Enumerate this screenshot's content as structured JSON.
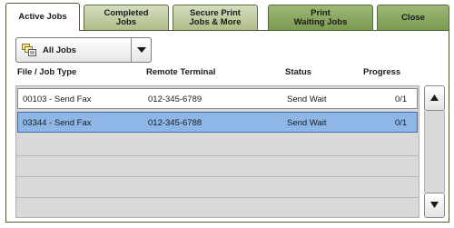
{
  "tabs": [
    {
      "label_line1": "Active Jobs",
      "label_line2": ""
    },
    {
      "label_line1": "Completed",
      "label_line2": "Jobs"
    },
    {
      "label_line1": "Secure Print",
      "label_line2": "Jobs & More"
    },
    {
      "label_line1": "Print",
      "label_line2": "Waiting Jobs"
    },
    {
      "label_line1": "Close",
      "label_line2": ""
    }
  ],
  "filter": {
    "selected": "All Jobs",
    "icon": "job-list-icon"
  },
  "columns": {
    "file_job_type": "File / Job Type",
    "remote_terminal": "Remote Terminal",
    "status": "Status",
    "progress": "Progress"
  },
  "rows": [
    {
      "job": "00103 - Send Fax",
      "terminal": "012-345-6789",
      "status": "Send Wait",
      "progress": "0/1"
    },
    {
      "job": "03344 - Send Fax",
      "terminal": "012-345-6788",
      "status": "Send Wait",
      "progress": "0/1"
    }
  ],
  "scroll": {
    "up_icon": "arrow-up-icon",
    "down_icon": "arrow-down-icon"
  },
  "colors": {
    "tab_green": "#8fac62",
    "selected_row": "#8eb7e8",
    "frame": "#4f5d36"
  }
}
